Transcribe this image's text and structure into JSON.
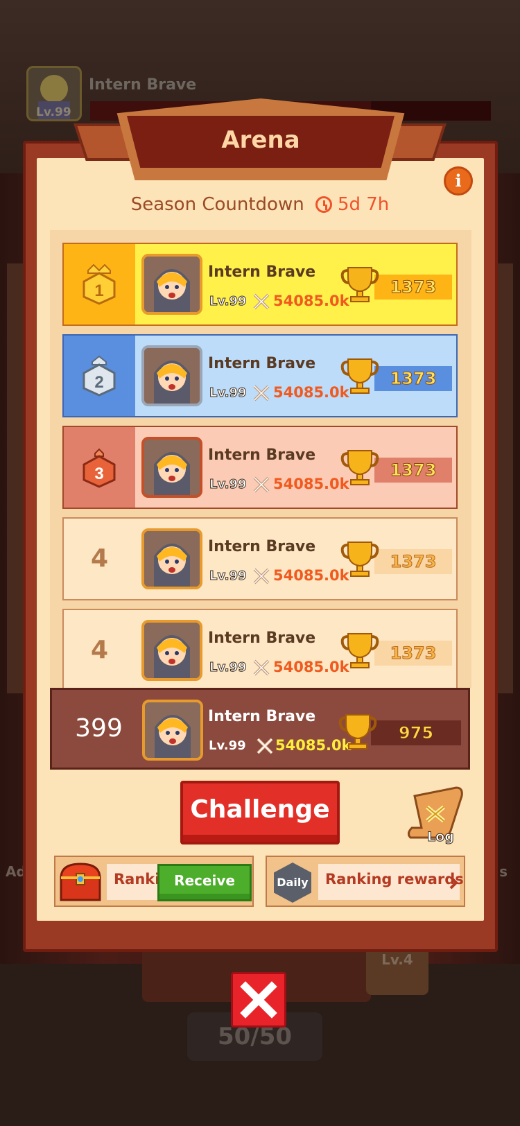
{
  "background": {
    "player_name": "Intern Brave",
    "player_level": "Lv.99",
    "left_label": "Ad",
    "right_label": "s",
    "chest_level": "Lv.4",
    "counter": "50/50"
  },
  "header": {
    "title": "Arena",
    "countdown_label": "Season Countdown",
    "countdown_value": "5d 7h"
  },
  "leaderboard": [
    {
      "rank": "1",
      "tier": "gold",
      "name": "Intern Brave",
      "level": "Lv.99",
      "power": "54085.0k",
      "score": "1373"
    },
    {
      "rank": "2",
      "tier": "silver",
      "name": "Intern Brave",
      "level": "Lv.99",
      "power": "54085.0k",
      "score": "1373"
    },
    {
      "rank": "3",
      "tier": "bronze",
      "name": "Intern Brave",
      "level": "Lv.99",
      "power": "54085.0k",
      "score": "1373"
    },
    {
      "rank": "4",
      "tier": "plain",
      "name": "Intern Brave",
      "level": "Lv.99",
      "power": "54085.0k",
      "score": "1373"
    },
    {
      "rank": "4",
      "tier": "plain",
      "name": "Intern Brave",
      "level": "Lv.99",
      "power": "54085.0k",
      "score": "1373"
    }
  ],
  "my_entry": {
    "rank": "399",
    "name": "Intern Brave",
    "level": "Lv.99",
    "power": "54085.0k",
    "score": "975"
  },
  "actions": {
    "challenge_label": "Challenge",
    "log_label": "Log"
  },
  "rewards": {
    "left_label": "Ranking rewards",
    "receive_label": "Receive",
    "daily_badge": "Daily",
    "right_label": "Ranking rewards"
  },
  "colors": {
    "gold": "#ffb416",
    "silver": "#5a8ede",
    "bronze": "#e0806a",
    "accent_red": "#e23028",
    "receive_green": "#4cae2a"
  },
  "icons": [
    "info-icon",
    "clock-icon",
    "medal-icon",
    "swords-icon",
    "trophy-icon",
    "log-scroll-icon",
    "treasure-chest-icon",
    "chevron-right-icon",
    "close-icon"
  ]
}
